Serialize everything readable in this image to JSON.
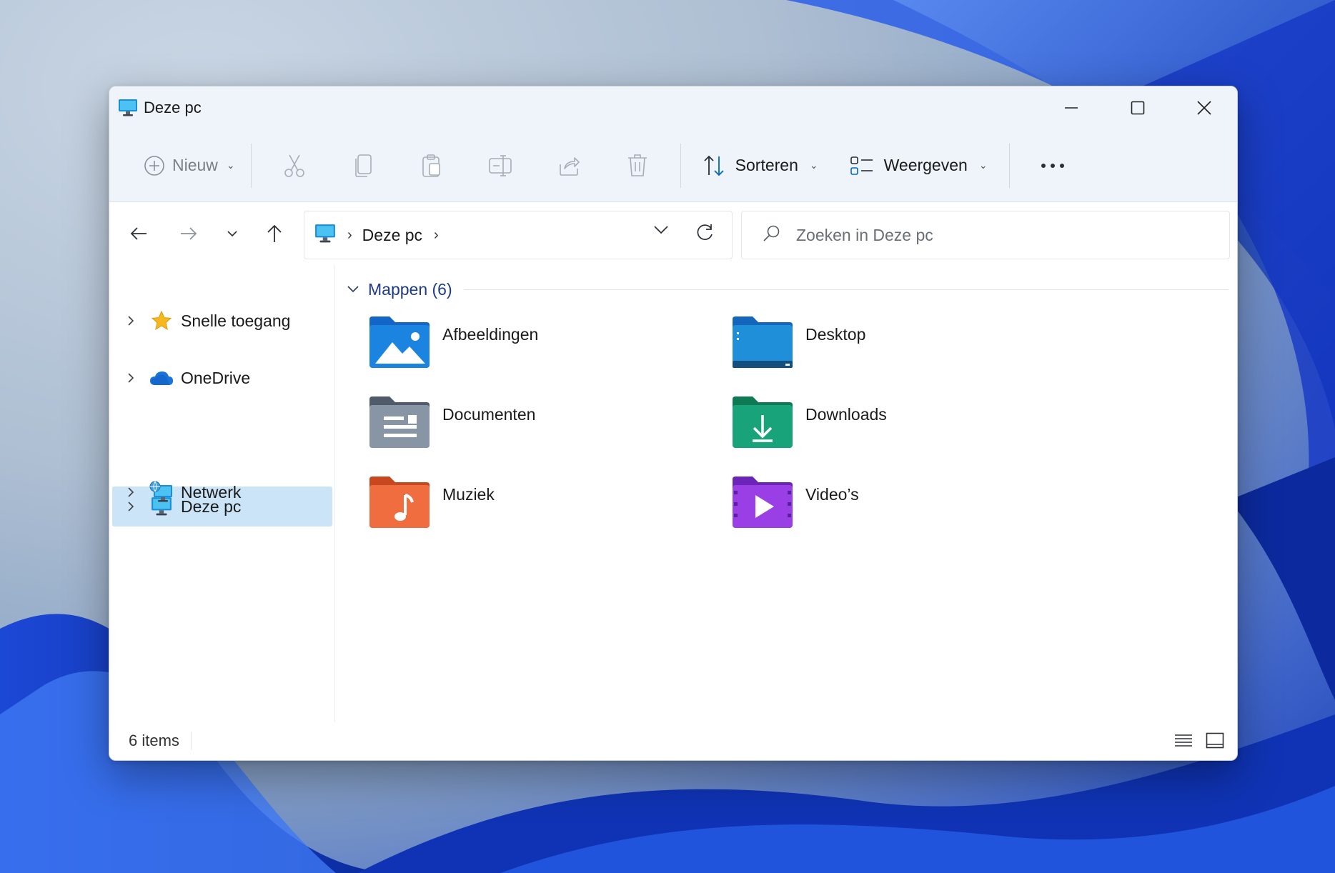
{
  "window": {
    "title": "Deze pc"
  },
  "toolbar": {
    "new_label": "Nieuw",
    "sort_label": "Sorteren",
    "view_label": "Weergeven",
    "icons": [
      "cut-icon",
      "copy-icon",
      "paste-icon",
      "rename-icon",
      "share-icon",
      "delete-icon",
      "more-icon"
    ]
  },
  "address": {
    "crumbs": [
      "Deze pc"
    ]
  },
  "search": {
    "placeholder": "Zoeken in Deze pc"
  },
  "sidebar": {
    "items": [
      {
        "label": "Snelle toegang",
        "icon": "star-icon",
        "selected": false
      },
      {
        "label": "OneDrive",
        "icon": "cloud-icon",
        "selected": false
      },
      {
        "label": "Deze pc",
        "icon": "pc-icon",
        "selected": true
      },
      {
        "label": "Netwerk",
        "icon": "network-icon",
        "selected": false
      }
    ]
  },
  "content": {
    "group_label": "Mappen (6)",
    "folders": [
      {
        "name": "Afbeeldingen",
        "icon": "pictures-folder-icon"
      },
      {
        "name": "Desktop",
        "icon": "desktop-folder-icon"
      },
      {
        "name": "Documenten",
        "icon": "documents-folder-icon"
      },
      {
        "name": "Downloads",
        "icon": "downloads-folder-icon"
      },
      {
        "name": "Muziek",
        "icon": "music-folder-icon"
      },
      {
        "name": "Video’s",
        "icon": "videos-folder-icon"
      }
    ]
  },
  "status": {
    "items_text": "6 items"
  },
  "colors": {
    "accent": "#0067c0",
    "selection": "#cce4f7",
    "titlebar": "#eef4f9"
  }
}
